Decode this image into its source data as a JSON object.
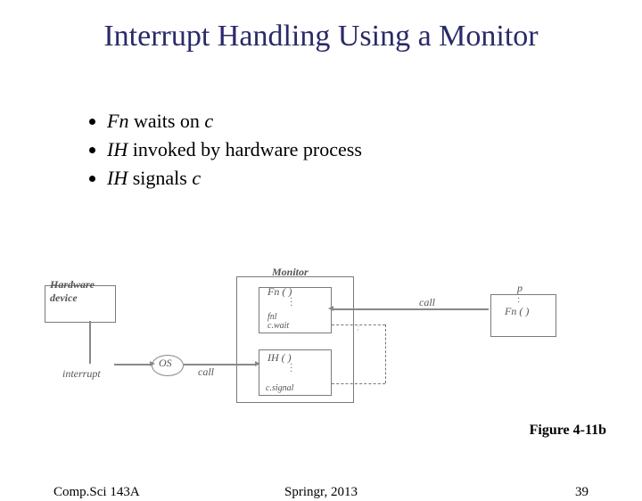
{
  "title": "Interrupt Handling Using a Monitor",
  "bullets": [
    {
      "em1": "Fn",
      "rest": " waits on ",
      "em2": "c"
    },
    {
      "em1": "IH",
      "rest": " invoked by hardware process",
      "em2": ""
    },
    {
      "em1": "IH",
      "rest": " signals ",
      "em2": "c"
    }
  ],
  "diagram": {
    "hardware_device": "Hardware\ndevice",
    "monitor": "Monitor",
    "fn_decl": "Fn ( )",
    "fnl": "fnl",
    "cwait": "c.wait",
    "ih_decl": "IH ( )",
    "csignal": "c.signal",
    "interrupt": "interrupt",
    "os": "OS",
    "call": "call",
    "call2": "call",
    "p": "p",
    "fn_call": "Fn ( )"
  },
  "figure_caption": "Figure 4-11b",
  "footer": {
    "left": "Comp.Sci 143A",
    "center": "Springr, 2013",
    "right": "39"
  }
}
